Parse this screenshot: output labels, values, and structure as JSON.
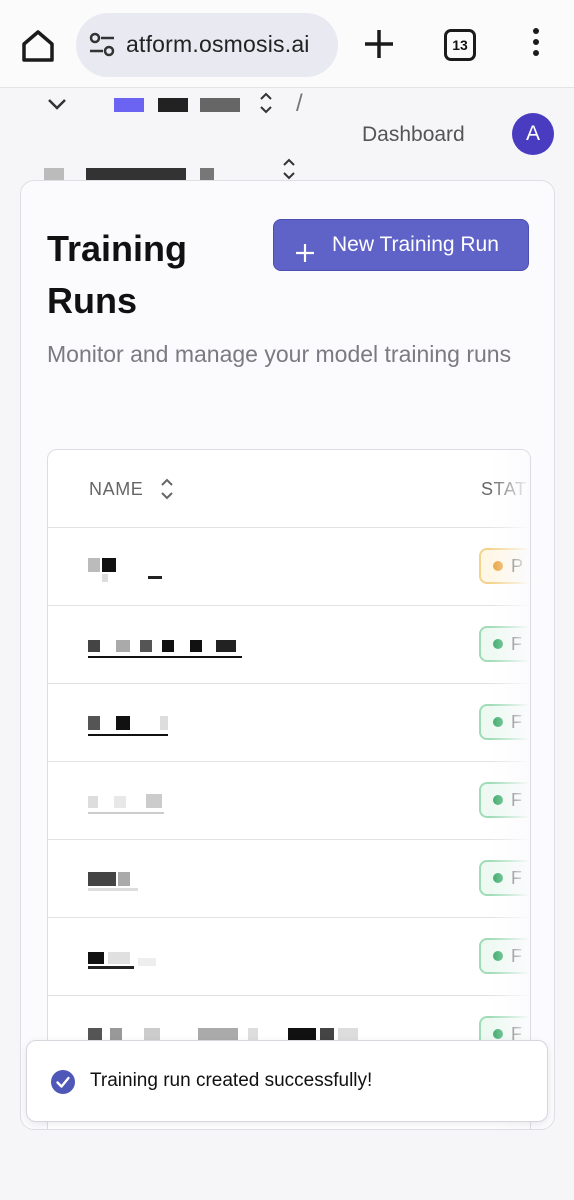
{
  "browser": {
    "url": "atform.osmosis.ai",
    "tab_count": "13",
    "icons": [
      "home-icon",
      "site-settings-icon",
      "new-tab-plus-icon",
      "tab-switcher-icon",
      "more-vert-icon"
    ]
  },
  "header": {
    "breadcrumb_separator": "/",
    "dashboard_label": "Dashboard",
    "avatar_initial": "A"
  },
  "page": {
    "title": "Training Runs",
    "subtitle": "Monitor and manage your model training runs",
    "new_button_label": "New Training Run"
  },
  "table": {
    "columns": [
      "NAME",
      "STAT"
    ],
    "rows": [
      {
        "name": "",
        "status_initial": "P",
        "status_kind": "pending"
      },
      {
        "name": "",
        "status_initial": "F",
        "status_kind": "ok"
      },
      {
        "name": "",
        "status_initial": "F",
        "status_kind": "ok"
      },
      {
        "name": "",
        "status_initial": "F",
        "status_kind": "ok"
      },
      {
        "name": "",
        "status_initial": "F",
        "status_kind": "ok"
      },
      {
        "name": "",
        "status_initial": "F",
        "status_kind": "ok"
      },
      {
        "name": "",
        "status_initial": "F",
        "status_kind": "ok"
      }
    ]
  },
  "toast": {
    "message": "Training run created successfully!",
    "icon": "check-circle-icon"
  },
  "colors": {
    "accent": "#5f63c7",
    "avatar": "#4a3cc0",
    "pending": "#e9a23b",
    "success": "#35a866"
  }
}
